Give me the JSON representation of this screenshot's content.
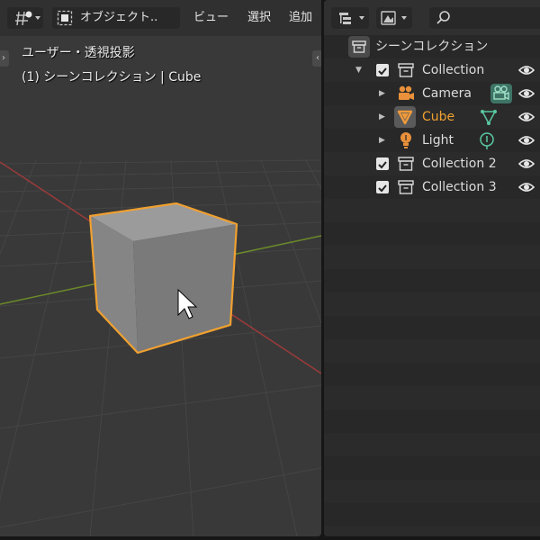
{
  "viewport": {
    "header": {
      "mode_label": "オブジェクト..",
      "menus": [
        "ビュー",
        "選択",
        "追加"
      ]
    },
    "overlay": {
      "line1": "ユーザー・透視投影",
      "line2": "(1) シーンコレクション | Cube"
    }
  },
  "outliner": {
    "scene_collection": "シーンコレクション",
    "rows": [
      {
        "label": "Collection",
        "kind": "collection",
        "expanded": true
      },
      {
        "label": "Camera",
        "kind": "camera"
      },
      {
        "label": "Cube",
        "kind": "mesh",
        "selected": true
      },
      {
        "label": "Light",
        "kind": "light"
      },
      {
        "label": "Collection 2",
        "kind": "collection"
      },
      {
        "label": "Collection 3",
        "kind": "collection"
      }
    ]
  },
  "colors": {
    "selection_orange": "#f0a030",
    "object_icon_orange": "#e8903a",
    "data_icon_green": "#58c9a0",
    "axis_red": "#9c3a3a",
    "axis_green": "#6b8a2a"
  },
  "icons": [
    "editor-type-icon",
    "object-mode-icon",
    "outliner-editor-icon",
    "display-mode-icon",
    "search-icon",
    "eye-icon",
    "collection-icon",
    "camera-icon",
    "mesh-icon",
    "light-icon",
    "camera-data-icon",
    "mesh-data-icon",
    "light-data-icon",
    "checkbox-icon",
    "expand-arrow-icon"
  ]
}
